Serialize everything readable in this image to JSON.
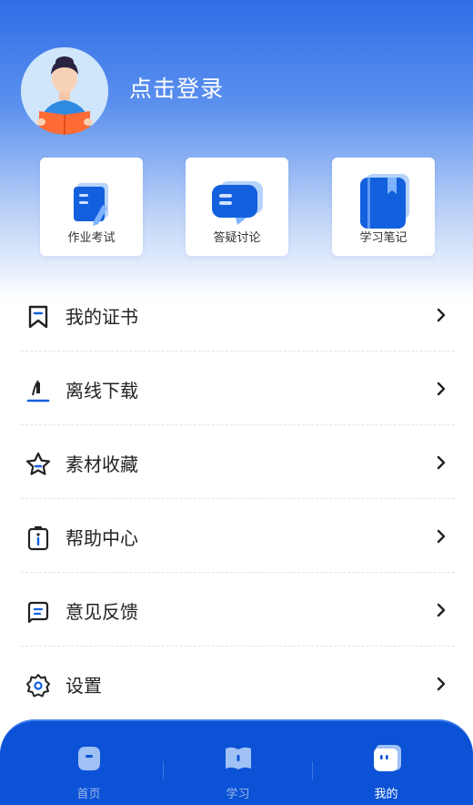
{
  "header": {
    "login_text": "点击登录"
  },
  "quick_actions": [
    {
      "label": "作业考试",
      "icon": "homework-icon"
    },
    {
      "label": "答疑讨论",
      "icon": "chat-bubble-icon"
    },
    {
      "label": "学习笔记",
      "icon": "notebook-icon"
    }
  ],
  "menu": [
    {
      "label": "我的证书",
      "icon": "bookmark-icon"
    },
    {
      "label": "离线下载",
      "icon": "download-icon"
    },
    {
      "label": "素材收藏",
      "icon": "star-icon"
    },
    {
      "label": "帮助中心",
      "icon": "info-icon"
    },
    {
      "label": "意见反馈",
      "icon": "feedback-icon"
    },
    {
      "label": "设置",
      "icon": "gear-icon"
    }
  ],
  "tabbar": {
    "tabs": [
      {
        "label": "首页",
        "icon": "home-icon"
      },
      {
        "label": "学习",
        "icon": "book-icon"
      },
      {
        "label": "我的",
        "icon": "profile-icon"
      }
    ],
    "active": "我的"
  },
  "colors": {
    "primary": "#0b52d6",
    "tab_inactive": "#9db8ea",
    "hero_top": "#2f6ee6"
  }
}
